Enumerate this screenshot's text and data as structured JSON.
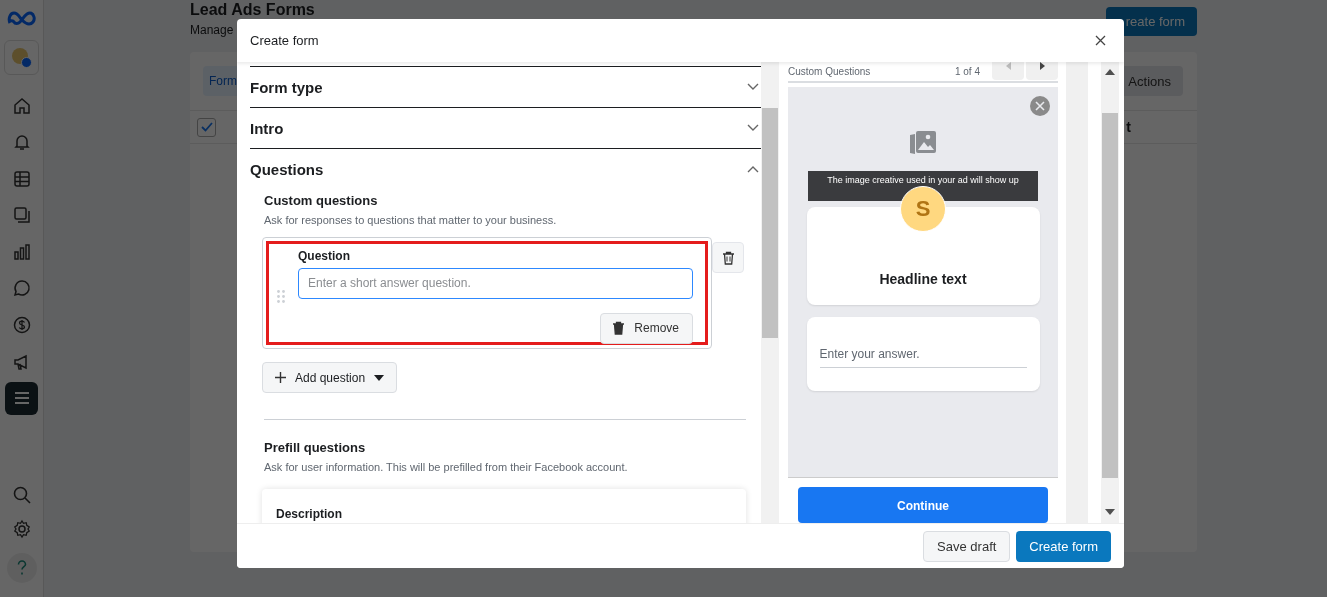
{
  "sidebar": {
    "items": [
      {
        "selected": false
      },
      {
        "selected": false
      },
      {
        "selected": false
      },
      {
        "selected": false
      },
      {
        "selected": false
      },
      {
        "selected": false
      },
      {
        "selected": false
      },
      {
        "selected": false
      },
      {
        "selected": true
      }
    ]
  },
  "page": {
    "title": "Lead Ads Forms",
    "subtitle": "Manage",
    "create_button": "reate form",
    "tab": "Form",
    "actions_button": "Actions",
    "select_all_checked": true,
    "column_header": "t"
  },
  "modal": {
    "title": "Create form",
    "sections": [
      {
        "title": "Form type",
        "expanded": false
      },
      {
        "title": "Intro",
        "expanded": false
      },
      {
        "title": "Questions",
        "expanded": true
      }
    ],
    "custom_questions": {
      "title": "Custom questions",
      "description": "Ask for responses to questions that matter to your business.",
      "question_label": "Question",
      "placeholder": "Enter a short answer question.",
      "remove_button": "Remove",
      "add_button": "Add question"
    },
    "prefill_questions": {
      "title": "Prefill questions",
      "description": "Ask for user information. This will be prefilled from their Facebook account.",
      "field_label": "Description"
    },
    "preview": {
      "header": "Custom Questions",
      "pager": "1 of 4",
      "banner": "The image creative used in your ad will show up",
      "avatar_letter": "S",
      "headline": "Headline text",
      "answer_placeholder": "Enter your answer.",
      "continue_button": "Continue"
    },
    "footer": {
      "buttons": [
        "Save draft",
        "Create form"
      ]
    }
  }
}
